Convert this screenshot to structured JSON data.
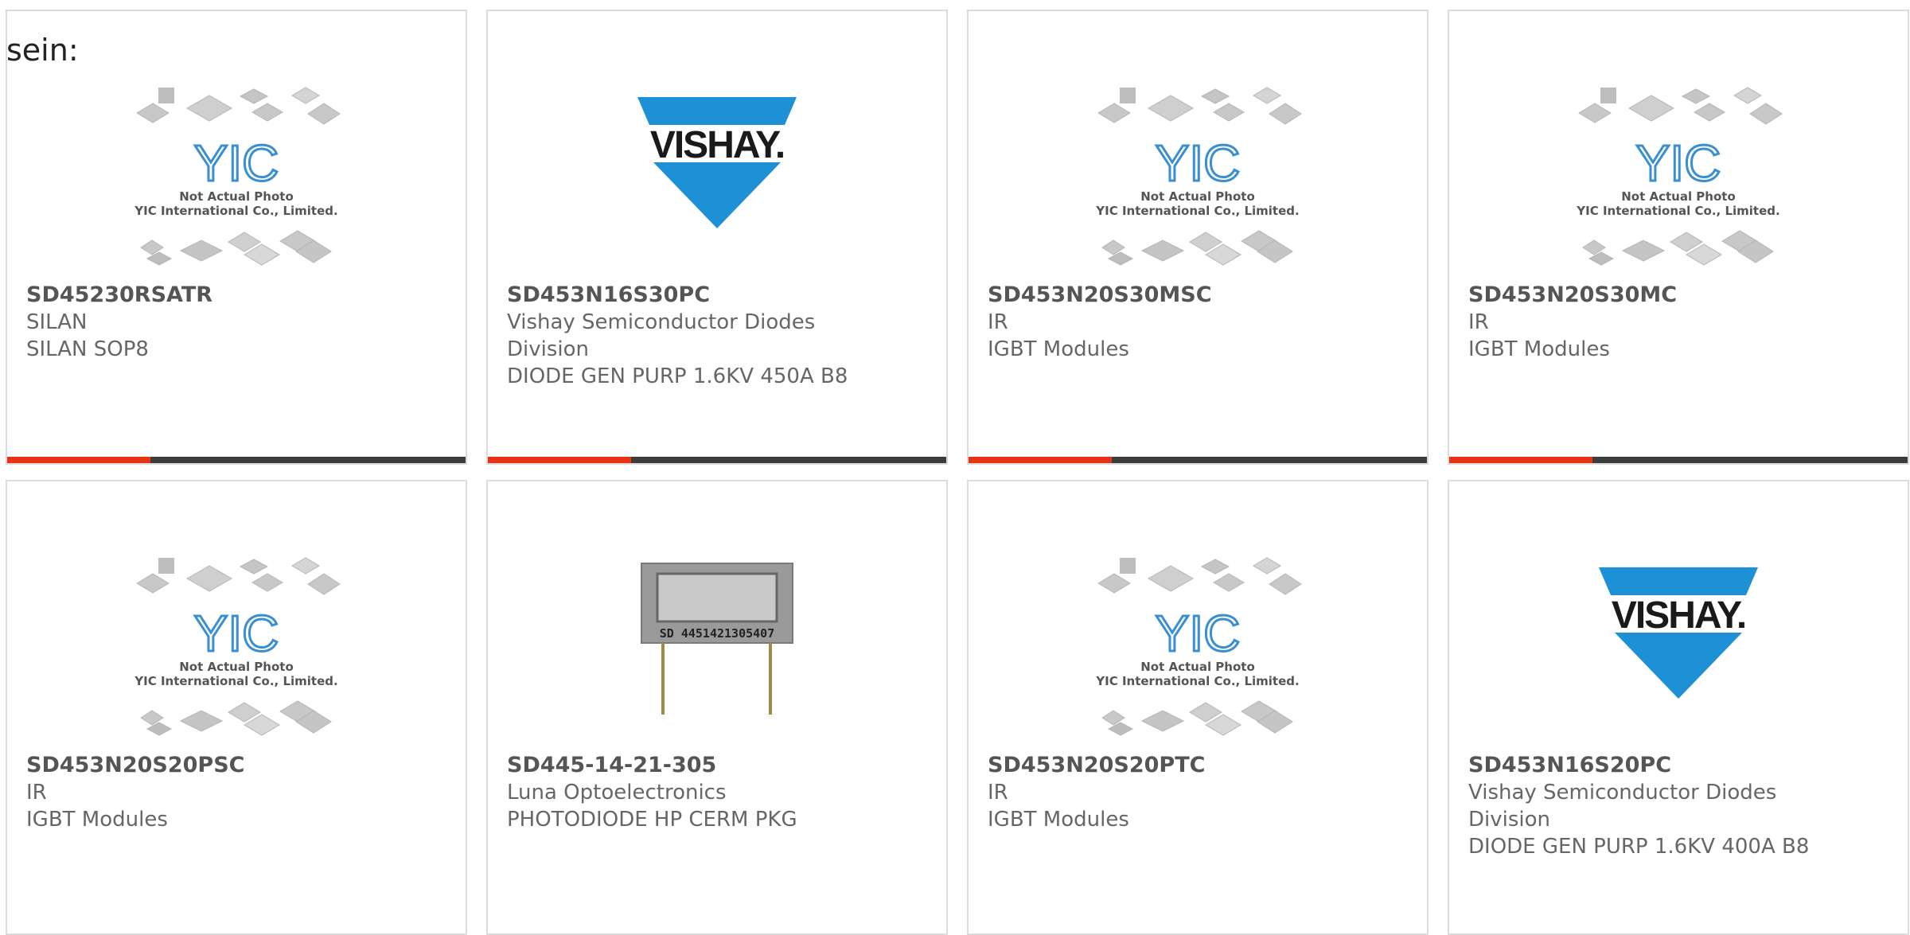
{
  "intro_text": "sein:",
  "colors": {
    "accent": "#e63312",
    "bar": "#3d3d3d",
    "card_border": "#dcdcdc",
    "text": "#555555",
    "vishay_blue": "#1e90d6",
    "yic_blue": "#3a8fd0"
  },
  "products": [
    {
      "part_number": "SD45230RSATR",
      "manufacturer": "SILAN",
      "manufacturer_line2": "",
      "description": "SILAN SOP8",
      "image": "yic-placeholder",
      "image_caption_1": "Not Actual Photo",
      "image_caption_2": "YIC International Co., Limited.",
      "show_bar": true
    },
    {
      "part_number": "SD453N16S30PC",
      "manufacturer": "Vishay Semiconductor Diodes",
      "manufacturer_line2": "Division",
      "description": "DIODE GEN PURP 1.6KV 450A B8",
      "image": "vishay-logo",
      "logo_text": "VISHAY.",
      "show_bar": true
    },
    {
      "part_number": "SD453N20S30MSC",
      "manufacturer": "IR",
      "manufacturer_line2": "",
      "description": "IGBT Modules",
      "image": "yic-placeholder",
      "image_caption_1": "Not Actual Photo",
      "image_caption_2": "YIC International Co., Limited.",
      "show_bar": true
    },
    {
      "part_number": "SD453N20S30MC",
      "manufacturer": "IR",
      "manufacturer_line2": "",
      "description": "IGBT Modules",
      "image": "yic-placeholder",
      "image_caption_1": "Not Actual Photo",
      "image_caption_2": "YIC International Co., Limited.",
      "show_bar": true
    },
    {
      "part_number": "SD453N20S20PSC",
      "manufacturer": "IR",
      "manufacturer_line2": "",
      "description": "IGBT Modules",
      "image": "yic-placeholder",
      "image_caption_1": "Not Actual Photo",
      "image_caption_2": "YIC International Co., Limited.",
      "show_bar": false
    },
    {
      "part_number": "SD445-14-21-305",
      "manufacturer": "Luna Optoelectronics",
      "manufacturer_line2": "",
      "description": "PHOTODIODE HP CERM PKG",
      "image": "photodiode-photo",
      "photo_text": "SD 4451421305407",
      "show_bar": false
    },
    {
      "part_number": "SD453N20S20PTC",
      "manufacturer": "IR",
      "manufacturer_line2": "",
      "description": "IGBT Modules",
      "image": "yic-placeholder",
      "image_caption_1": "Not Actual Photo",
      "image_caption_2": "YIC International Co., Limited.",
      "show_bar": false
    },
    {
      "part_number": "SD453N16S20PC",
      "manufacturer": "Vishay Semiconductor Diodes",
      "manufacturer_line2": "Division",
      "description": "DIODE GEN PURP 1.6KV 400A B8",
      "image": "vishay-logo",
      "logo_text": "VISHAY.",
      "show_bar": false
    }
  ]
}
